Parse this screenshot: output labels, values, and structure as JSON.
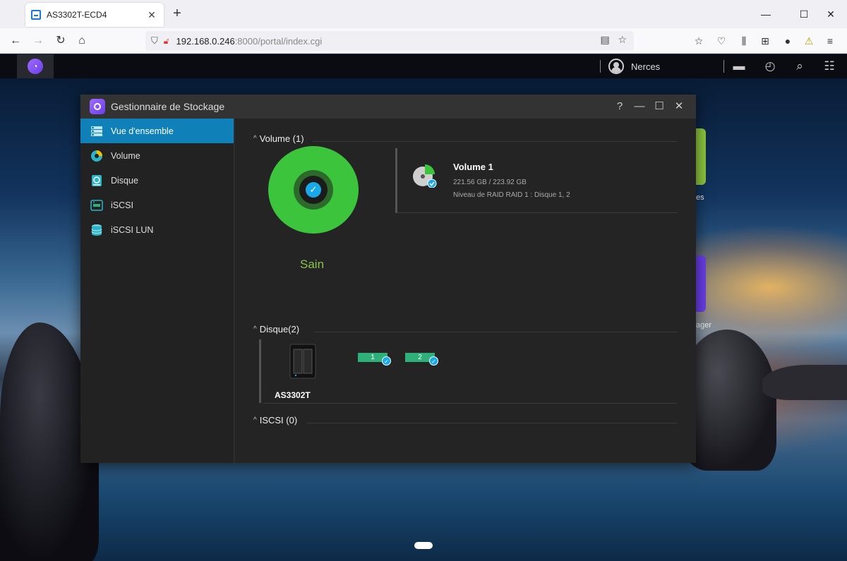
{
  "browser": {
    "tab_title": "AS3302T-ECD4",
    "url_host": "192.168.0.246",
    "url_path": ":8000/portal/index.cgi"
  },
  "taskbar": {
    "username": "Nerces"
  },
  "desktop": {
    "label_1": "es",
    "label_2": "ager"
  },
  "window": {
    "title": "Gestionnaire de Stockage"
  },
  "sidebar": {
    "items": [
      {
        "label": "Vue d'ensemble"
      },
      {
        "label": "Volume"
      },
      {
        "label": "Disque"
      },
      {
        "label": "iSCSI"
      },
      {
        "label": "iSCSI LUN"
      }
    ]
  },
  "volume_section": {
    "heading": "Volume (1)",
    "status": "Sain",
    "volume_name": "Volume 1",
    "volume_size": "221.56 GB / 223.92 GB",
    "raid_info": "Niveau de RAID RAID 1 : Disque 1, 2"
  },
  "disk_section": {
    "heading": "Disque(2)",
    "device": "AS3302T",
    "slots": [
      "1",
      "2"
    ]
  },
  "iscsi_section": {
    "heading": "ISCSI (0)"
  },
  "colors": {
    "accent": "#0f80b8",
    "healthy": "#3cc43c",
    "status_text": "#8bc34a",
    "check": "#1aa9e8"
  }
}
